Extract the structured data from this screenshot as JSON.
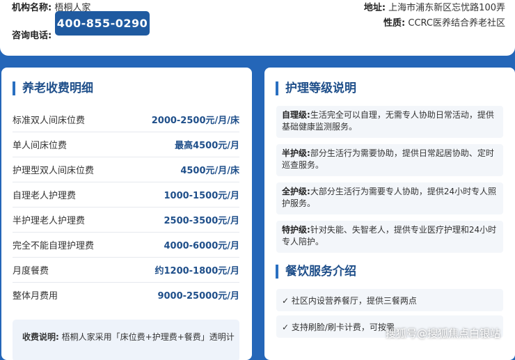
{
  "info": {
    "name_label": "机构名称:",
    "name_value": "梧桐人家",
    "phone_label": "咨询电话:",
    "phone": "400-855-0290",
    "address_label": "地址:",
    "address_value": "上海市浦东新区忘忧路100弄",
    "type_label": "性质:",
    "type_value": "CCRC医养结合养老社区"
  },
  "fees": {
    "title": "养老收费明细",
    "items": [
      {
        "name": "标准双人间床位费",
        "price": "2000-2500元/月/床"
      },
      {
        "name": "单人间床位费",
        "price": "最高4500元/月"
      },
      {
        "name": "护理型双人间床位费",
        "price": "4500元/月/床"
      },
      {
        "name": "自理老人护理费",
        "price": "1000-1500元/月"
      },
      {
        "name": "半护理老人护理费",
        "price": "2500-3500元/月"
      },
      {
        "name": "完全不能自理护理费",
        "price": "4000-6000元/月"
      },
      {
        "name": "月度餐费",
        "price": "约1200-1800元/月"
      },
      {
        "name": "整体月费用",
        "price": "9000-25000元/月"
      }
    ],
    "note_label": "收费说明:",
    "note_text": "梧桐人家采用「床位费+护理费+餐费」透明计"
  },
  "levels": {
    "title": "护理等级说明",
    "items": [
      {
        "label": "自理级:",
        "line1": "生活完全可以自理，无需专人协助日常活动，提供",
        "line2": "基础健康监测服务。"
      },
      {
        "label": "半护级:",
        "line1": "部分生活行为需要协助，提供日常起居协助、定时",
        "line2": "巡查服务。"
      },
      {
        "label": "全护级:",
        "line1": "大部分生活行为需要专人协助，提供24小时专人照",
        "line2": "护服务。"
      },
      {
        "label": "特护级:",
        "line1": "针对失能、失智老人，提供专业医疗护理和24小时",
        "line2": "专人陪护。"
      }
    ]
  },
  "meals": {
    "title": "餐饮服务介绍",
    "items": [
      {
        "text": "✓ 社区内设营养餐厅，提供三餐两点"
      },
      {
        "text": "✓ 支持刷脸/刷卡计费，可按需"
      }
    ]
  },
  "watermark": "搜狐号@搜狐焦点白银站",
  "colors": {
    "background": "#2466b8",
    "accent": "#1f4f8a",
    "phone_button": "#1f5aa0"
  }
}
